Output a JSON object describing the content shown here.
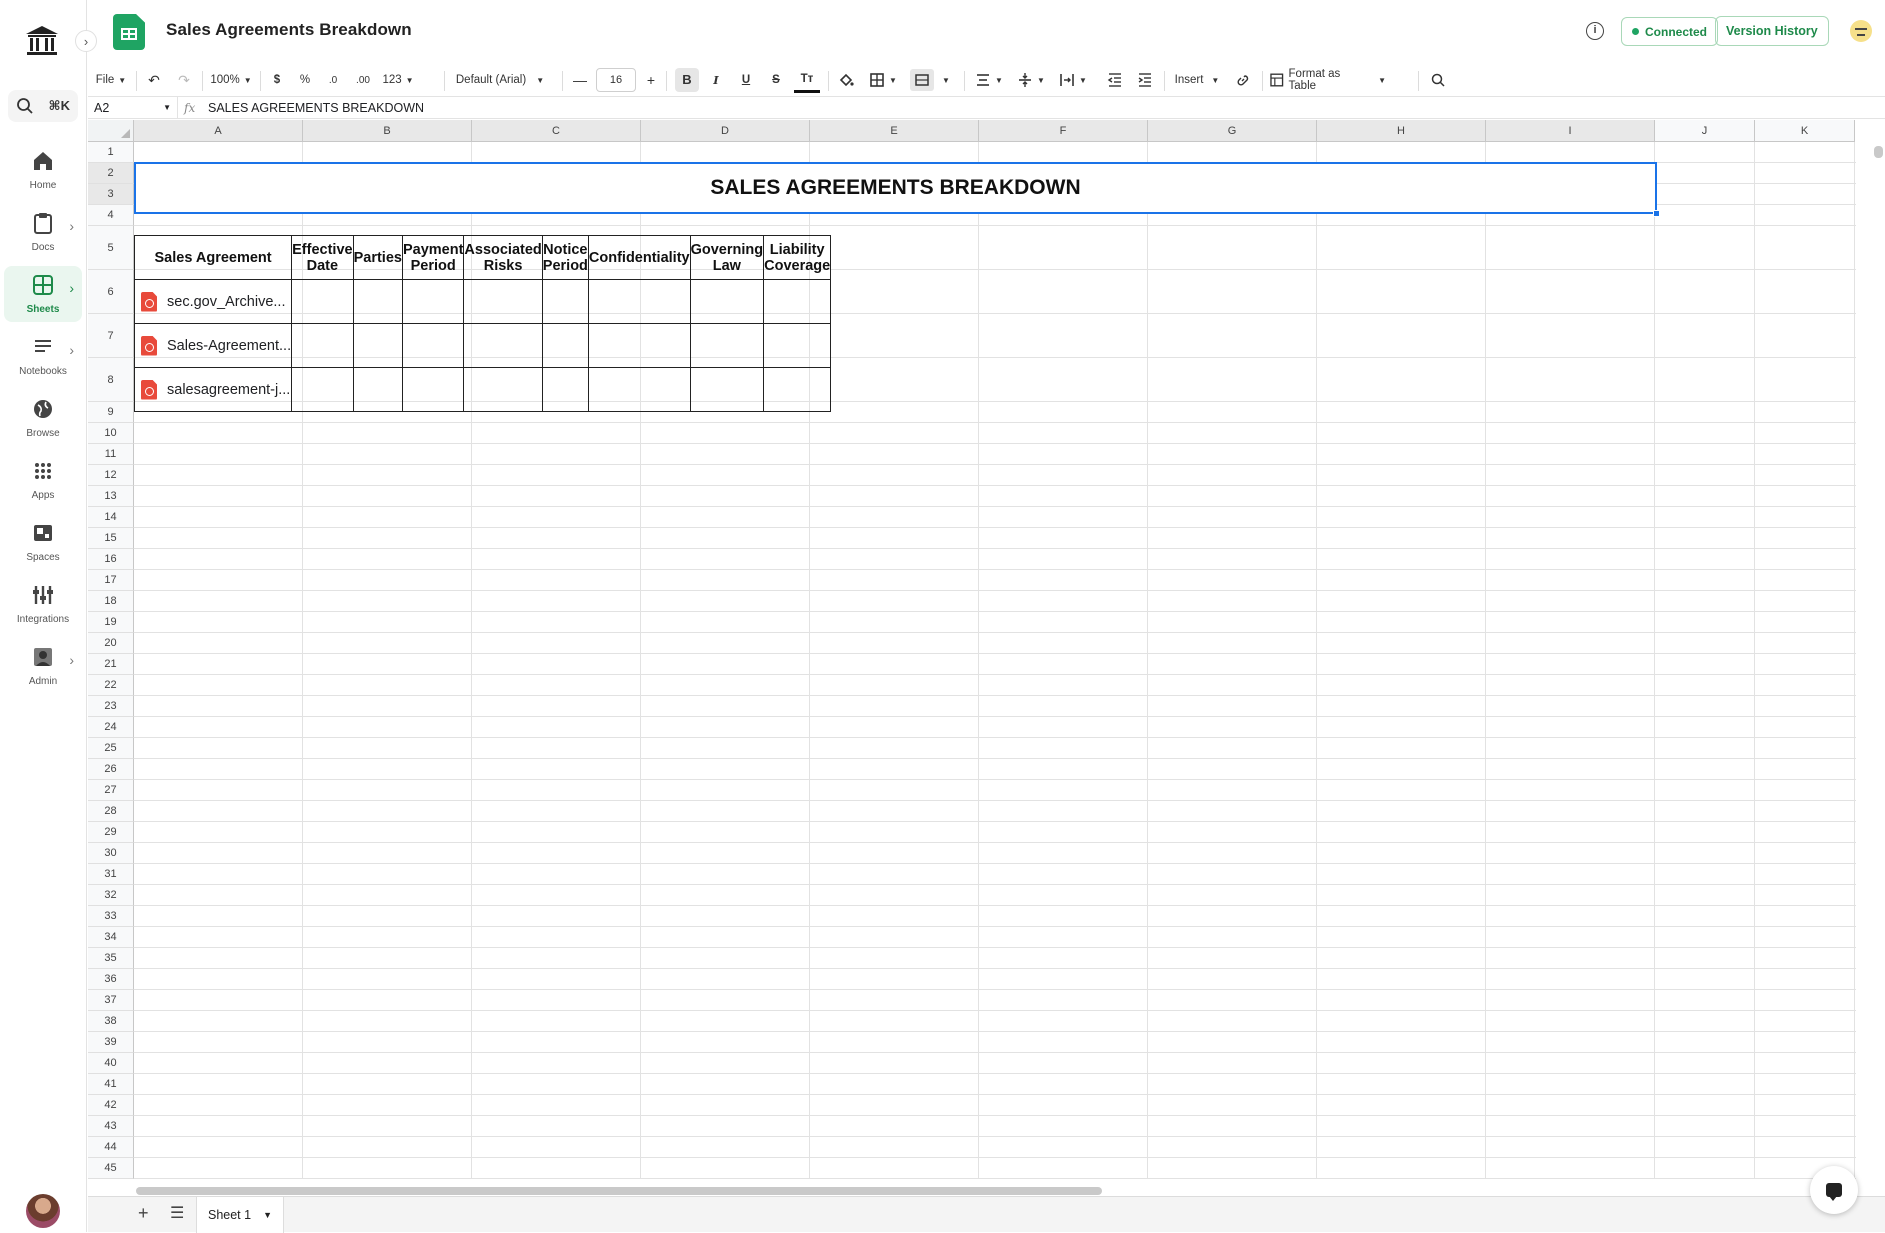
{
  "app": {
    "title": "Sales Agreements Breakdown",
    "status": "Connected",
    "version_history": "Version History",
    "info": "i"
  },
  "rail": {
    "search_shortcut": "⌘K",
    "items": [
      {
        "label": "Home",
        "icon": "home-icon"
      },
      {
        "label": "Docs",
        "icon": "clipboard-icon"
      },
      {
        "label": "Sheets",
        "icon": "grid-icon"
      },
      {
        "label": "Notebooks",
        "icon": "lines-icon"
      },
      {
        "label": "Browse",
        "icon": "globe-icon"
      },
      {
        "label": "Apps",
        "icon": "apps-icon"
      },
      {
        "label": "Spaces",
        "icon": "spaces-icon"
      },
      {
        "label": "Integrations",
        "icon": "integrations-icon"
      },
      {
        "label": "Admin",
        "icon": "admin-icon"
      }
    ]
  },
  "toolbar": {
    "file": "File",
    "zoom": "100%",
    "currency": "$",
    "percent": "%",
    "dec_decrease": ".0",
    "dec_increase": ".00",
    "number_format": "123",
    "font": "Default (Arial)",
    "font_size": "16",
    "bold": "B",
    "italic": "I",
    "underline": "U",
    "strike": "S",
    "text_transform": "Tт",
    "insert": "Insert",
    "format_table": "Format as Table"
  },
  "formula_bar": {
    "cell_ref": "A2",
    "fx": "fx",
    "value": "SALES AGREEMENTS BREAKDOWN"
  },
  "grid": {
    "columns": [
      "A",
      "B",
      "C",
      "D",
      "E",
      "F",
      "G",
      "H",
      "I",
      "J",
      "K"
    ],
    "row_count": 45,
    "title": "SALES AGREEMENTS BREAKDOWN",
    "headers": [
      "Sales Agreement",
      "Effective Date",
      "Parties",
      "Payment Period",
      "Associated Risks",
      "Notice Period",
      "Confidentiality",
      "Governing Law",
      "Liability Coverage"
    ],
    "rows": [
      [
        "sec.gov_Archive...",
        "",
        "",
        "",
        "",
        "",
        "",
        "",
        ""
      ],
      [
        "Sales-Agreement...",
        "",
        "",
        "",
        "",
        "",
        "",
        "",
        ""
      ],
      [
        "salesagreement-j...",
        "",
        "",
        "",
        "",
        "",
        "",
        "",
        ""
      ]
    ]
  },
  "sheets": {
    "tabs": [
      "Sheet 1"
    ]
  },
  "colors": {
    "accent": "#1fa463",
    "selection": "#1a73e8",
    "pdf": "#e84a3b"
  }
}
